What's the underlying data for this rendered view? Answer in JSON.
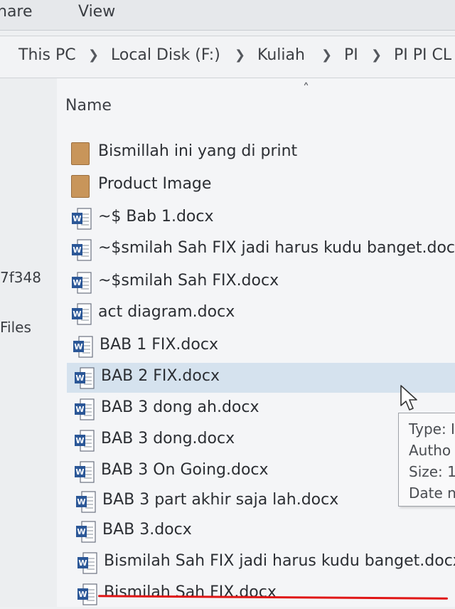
{
  "ribbon": {
    "tabs": [
      "hare",
      "View"
    ]
  },
  "address_bar": {
    "crumbs": [
      "This PC",
      "Local Disk (F:)",
      "Kuliah",
      "PI",
      "PI PI CL"
    ]
  },
  "nav_pane": {
    "items": [
      "7f348",
      "Files"
    ]
  },
  "file_list": {
    "column_header": "Name",
    "items": [
      {
        "name": "Bismillah ini yang di print",
        "type": "folder"
      },
      {
        "name": "Product Image",
        "type": "folder"
      },
      {
        "name": "~$ Bab 1.docx",
        "type": "docx"
      },
      {
        "name": "~$smilah Sah FIX jadi harus kudu banget.docx",
        "type": "docx"
      },
      {
        "name": "~$smilah Sah FIX.docx",
        "type": "docx"
      },
      {
        "name": "act diagram.docx",
        "type": "docx"
      },
      {
        "name": "BAB 1 FIX.docx",
        "type": "docx"
      },
      {
        "name": "BAB 2 FIX.docx",
        "type": "docx",
        "selected": true
      },
      {
        "name": "BAB 3 dong ah.docx",
        "type": "docx"
      },
      {
        "name": "BAB 3 dong.docx",
        "type": "docx"
      },
      {
        "name": "BAB 3 On Going.docx",
        "type": "docx"
      },
      {
        "name": "BAB 3 part akhir saja lah.docx",
        "type": "docx"
      },
      {
        "name": "BAB 3.docx",
        "type": "docx"
      },
      {
        "name": "Bismilah Sah FIX jadi harus kudu banget.docx",
        "type": "docx",
        "underlined": true
      },
      {
        "name": "Bismilah Sah FIX.docx",
        "type": "docx"
      }
    ]
  },
  "tooltip": {
    "lines": [
      "Type: I",
      "Autho",
      "Size: 1",
      "Date n"
    ]
  },
  "colors": {
    "selection": "#d5e2ee",
    "underline": "#e01616",
    "folder": "#c8955a",
    "word_blue": "#2b5797"
  }
}
